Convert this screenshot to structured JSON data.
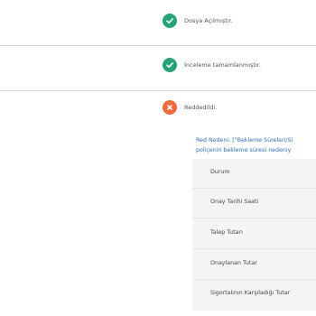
{
  "steps": [
    {
      "label": "Dosya Açılmıştır.",
      "status": "done",
      "icon": "check-icon"
    },
    {
      "label": "İnceleme tamamlanmıştır.",
      "status": "done",
      "icon": "check-icon"
    },
    {
      "label": "Reddedildi.",
      "status": "rejected",
      "icon": "x-icon"
    }
  ],
  "colors": {
    "done": "#27a37a",
    "rejected": "#f26b3a",
    "link": "#2f6fb6"
  },
  "reason": {
    "line1": "Red Nedeni: [\"Bekleme Süreleri/Si",
    "line2": "poliçenin bekleme süresi nedeniy"
  },
  "details": {
    "rows": [
      "Durum",
      "Onay Tarihi Saati",
      "Talep Tutarı",
      "Onaylanan Tutar",
      "Sigortalının Karşıladığı Tutar"
    ]
  }
}
